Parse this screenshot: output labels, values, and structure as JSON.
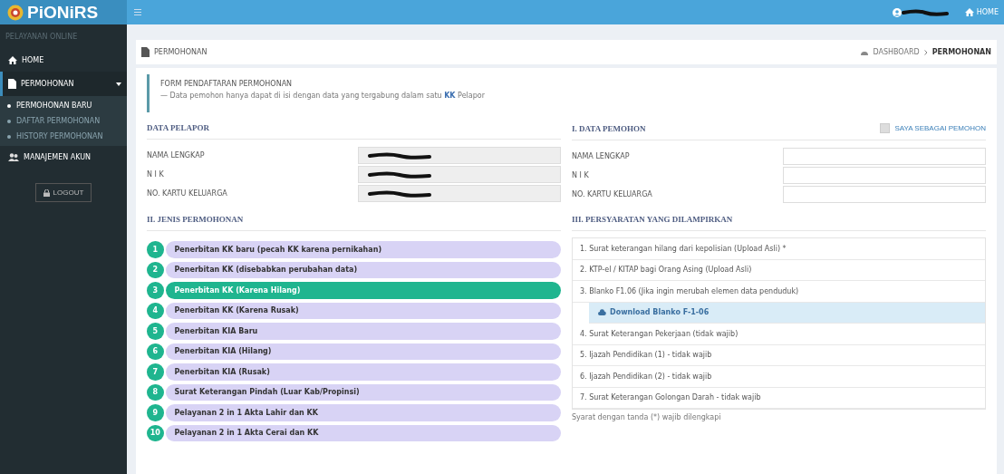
{
  "header": {
    "logo": "PiONiRS",
    "user_redacted": true,
    "home_link": "HOME"
  },
  "sidebar": {
    "subtitle": "PELAYANAN ONLINE",
    "items": [
      {
        "label": "HOME",
        "kind": "home",
        "selected": false
      },
      {
        "label": "PERMOHONAN",
        "kind": "document",
        "selected": true,
        "expanded": true,
        "children": [
          {
            "label": "PERMOHONAN BARU",
            "selected": true
          },
          {
            "label": "DAFTAR PERMOHONAN",
            "selected": false
          },
          {
            "label": "HISTORY PERMOHONAN",
            "selected": false
          }
        ]
      },
      {
        "label": "MANAJEMEN AKUN",
        "kind": "users",
        "selected": false
      }
    ],
    "logout": "LOGOUT"
  },
  "page_title": "PERMOHONAN",
  "breadcrumb": [
    "DASHBOARD",
    "PERMOHONAN"
  ],
  "callout": {
    "title": "FORM PENDAFTARAN PERMOHONAN",
    "note": "— Data pemohon hanya dapat di isi dengan data yang tergabung dalam satu **KK** Pelapor"
  },
  "pelapor": {
    "title": "DATA PELAPOR",
    "fields": [
      {
        "label": "NAMA LENGKAP",
        "redacted": true
      },
      {
        "label": "N I K",
        "redacted": true
      },
      {
        "label": "NO. KARTU KELUARGA",
        "redacted": true
      }
    ]
  },
  "pemohon": {
    "title": "I. DATA PEMOHON",
    "self_checkbox": {
      "label": "SAYA SEBAGAI PEMOHON",
      "checked": false
    },
    "fields": [
      {
        "label": "NAMA LENGKAP"
      },
      {
        "label": "N I K"
      },
      {
        "label": "NO. KARTU KELUARGA"
      }
    ]
  },
  "jenis": {
    "title": "II. JENIS PERMOHONAN",
    "items": [
      {
        "number": "1",
        "label": "Penerbitan KK baru (pecah KK karena pernikahan)",
        "selected": false
      },
      {
        "number": "2",
        "label": "Penerbitan KK (disebabkan perubahan data)",
        "selected": false
      },
      {
        "number": "3",
        "label": "Penerbitan KK (Karena Hilang)",
        "selected": true
      },
      {
        "number": "4",
        "label": "Penerbitan KK (Karena Rusak)",
        "selected": false
      },
      {
        "number": "5",
        "label": "Penerbitan KIA Baru",
        "selected": false
      },
      {
        "number": "6",
        "label": "Penerbitan KIA (Hilang)",
        "selected": false
      },
      {
        "number": "7",
        "label": "Penerbitan KIA (Rusak)",
        "selected": false
      },
      {
        "number": "8",
        "label": "Surat Keterangan Pindah (Luar Kab/Propinsi)",
        "selected": false
      },
      {
        "number": "9",
        "label": "Pelayanan 2 in 1 Akta Lahir dan KK",
        "selected": false
      },
      {
        "number": "10",
        "label": "Pelayanan 2 in 1 Akta Cerai dan KK",
        "selected": false
      }
    ]
  },
  "persyaratan": {
    "title": "III. PERSYARATAN YANG DILAMPIRKAN",
    "items": [
      {
        "kind": "item",
        "label": "1. Surat keterangan hilang dari kepolisian (Upload Asli) *"
      },
      {
        "kind": "item",
        "label": "2. KTP-el / KITAP bagi Orang Asing (Upload Asli)"
      },
      {
        "kind": "item",
        "label": "3. Blanko F1.06 (Jika ingin merubah elemen data penduduk)"
      },
      {
        "kind": "download",
        "label": "Download Blanko F-1-06"
      },
      {
        "kind": "item",
        "label": "4. Surat Keterangan Pekerjaan (tidak wajib)"
      },
      {
        "kind": "item",
        "label": "5. Ijazah Pendidikan (1) - tidak wajib"
      },
      {
        "kind": "item",
        "label": "6. Ijazah Pendidikan (2) - tidak wajib"
      },
      {
        "kind": "item",
        "label": "7. Surat Keterangan Golongan Darah - tidak wajib"
      }
    ],
    "footnote": "Syarat dengan tanda (*) wajib dilengkapi"
  }
}
